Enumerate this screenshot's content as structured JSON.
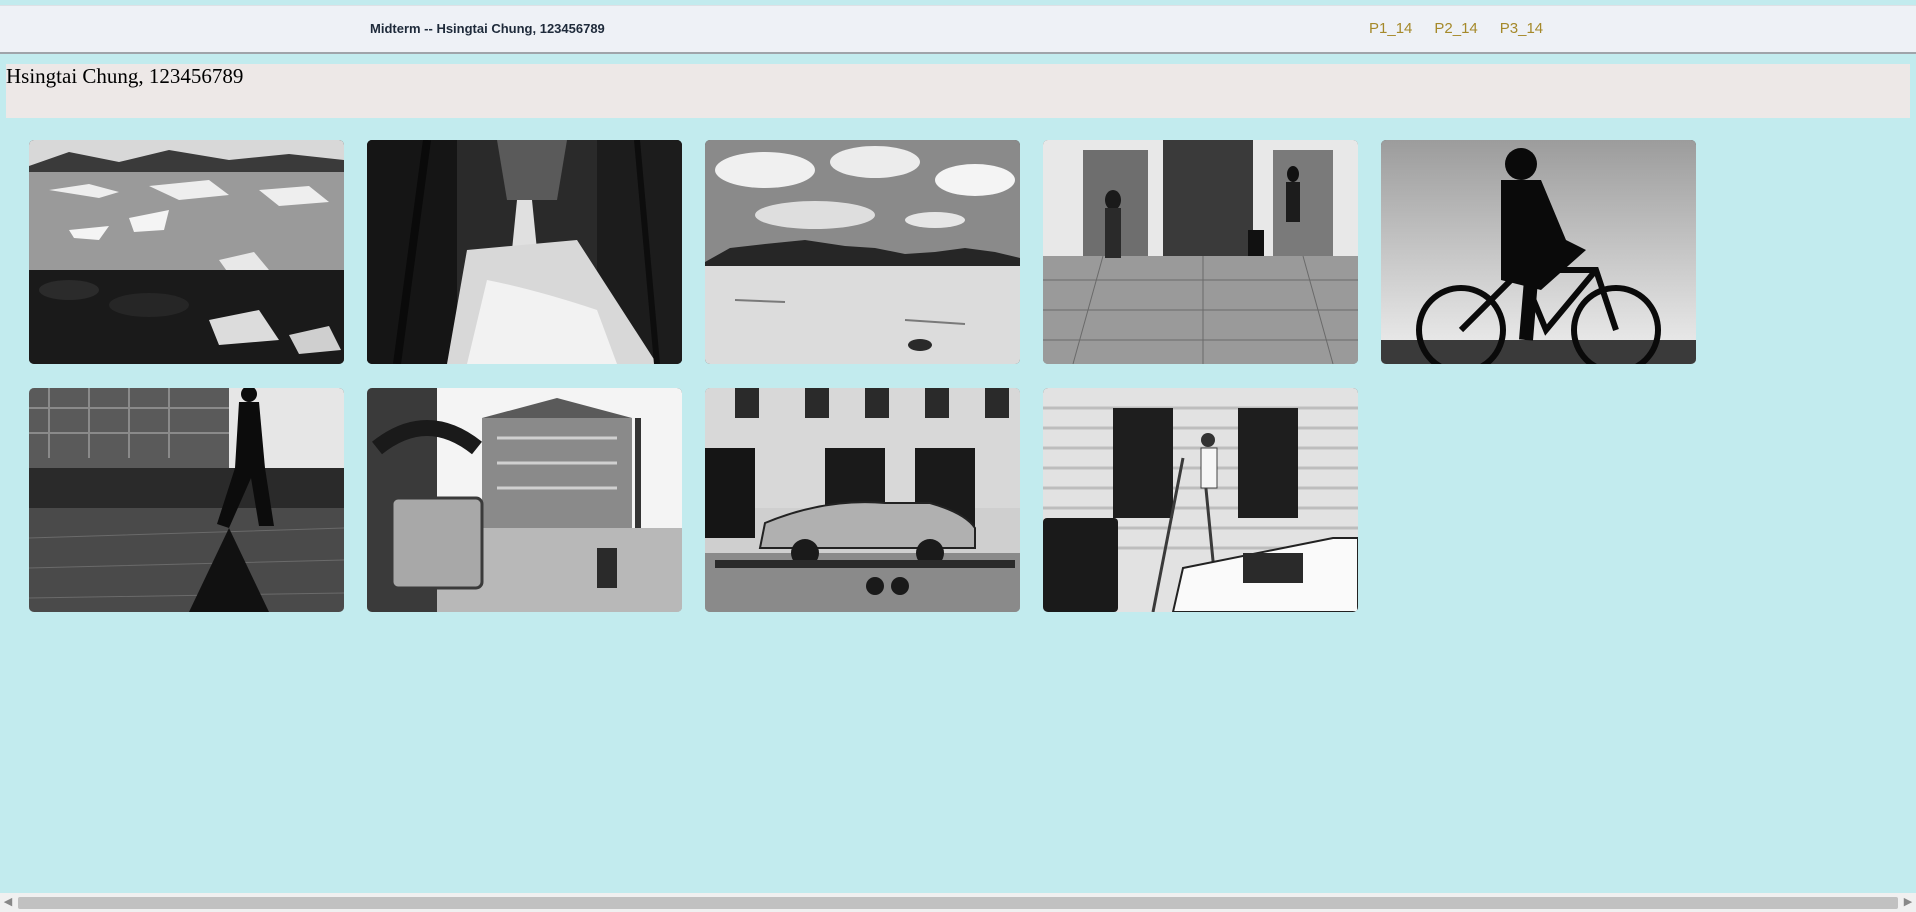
{
  "header": {
    "site_title": "Midterm -- Hsingtai Chung, 123456789",
    "nav": [
      {
        "label": "P1_14"
      },
      {
        "label": "P2_14"
      },
      {
        "label": "P3_14"
      }
    ]
  },
  "banner": {
    "text": "Hsingtai Chung, 123456789"
  },
  "gallery": {
    "photos": [
      {
        "subject": "glacier lagoon with icebergs"
      },
      {
        "subject": "forest waterfall"
      },
      {
        "subject": "desert with mountains and clouds"
      },
      {
        "subject": "people walking by elevators"
      },
      {
        "subject": "cyclist silhouette"
      },
      {
        "subject": "man walking by river in city"
      },
      {
        "subject": "padlock with building background"
      },
      {
        "subject": "vintage car on trailer"
      },
      {
        "subject": "painter on ladder by building"
      }
    ]
  },
  "icons": {
    "scroll_left": "triangle-left-icon",
    "scroll_right": "triangle-right-icon"
  },
  "colors": {
    "page_background": "#c2ebee",
    "nav_link": "#a5892a",
    "topbar": "#eef1f6",
    "banner": "#ede8e7"
  }
}
